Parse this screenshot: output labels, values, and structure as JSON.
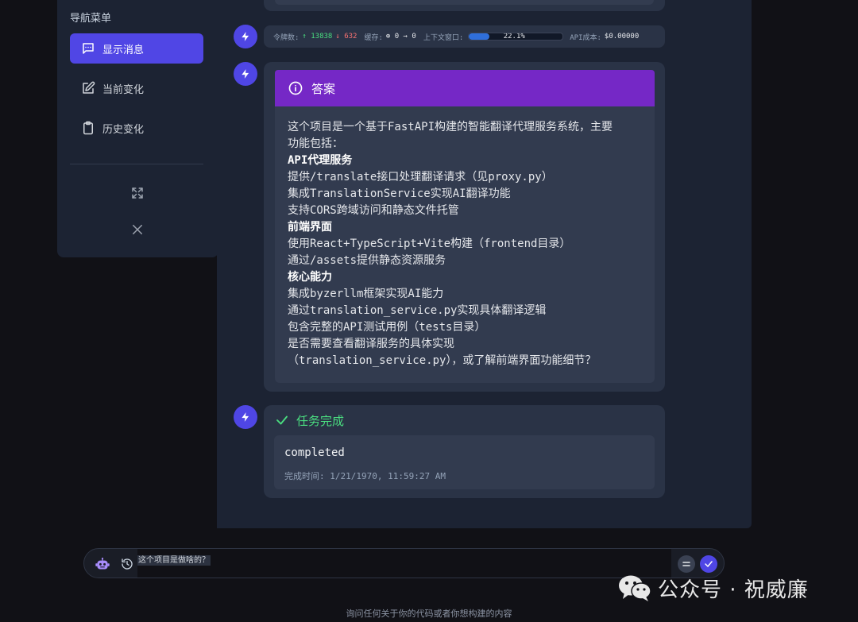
{
  "sidebar": {
    "title": "导航菜单",
    "items": [
      {
        "label": "显示消息",
        "icon": "chat-bubble-icon",
        "active": true
      },
      {
        "label": "当前变化",
        "icon": "edit-icon",
        "active": false
      },
      {
        "label": "历史变化",
        "icon": "clipboard-icon",
        "active": false
      }
    ],
    "expand_icon": "expand-icon",
    "close_icon": "close-icon"
  },
  "token_bar": {
    "tokens_label": "令牌数:",
    "tokens_up": "↑ 13838",
    "tokens_down": "↓ 632",
    "cache_label": "缓存:",
    "cache_value": "⊕ 0 → 0",
    "context_label": "上下文窗口:",
    "context_percent": 22.1,
    "context_percent_text": "22.1%",
    "cost_label": "API成本:",
    "cost_value": "$0.00000"
  },
  "answer": {
    "title": "答案",
    "lines": [
      {
        "text": "这个项目是一个基于FastAPI构建的智能翻译代理服务系统，主要",
        "bold": false
      },
      {
        "text": "功能包括：",
        "bold": false
      },
      {
        "text": "API代理服务",
        "bold": true
      },
      {
        "text": "提供/translate接口处理翻译请求（见proxy.py）",
        "bold": false
      },
      {
        "text": "集成TranslationService实现AI翻译功能",
        "bold": false
      },
      {
        "text": "支持CORS跨域访问和静态文件托管",
        "bold": false
      },
      {
        "text": "前端界面",
        "bold": true
      },
      {
        "text": "使用React+TypeScript+Vite构建（frontend目录）",
        "bold": false
      },
      {
        "text": "通过/assets提供静态资源服务",
        "bold": false
      },
      {
        "text": "核心能力",
        "bold": true
      },
      {
        "text": "集成byzerllm框架实现AI能力",
        "bold": false
      },
      {
        "text": "通过translation_service.py实现具体翻译逻辑",
        "bold": false
      },
      {
        "text": "包含完整的API测试用例（tests目录）",
        "bold": false
      },
      {
        "text": "是否需要查看翻译服务的具体实现",
        "bold": false
      },
      {
        "text": "（translation_service.py），或了解前端界面功能细节？",
        "bold": false
      }
    ]
  },
  "task": {
    "title": "任务完成",
    "status": "completed",
    "time": "完成时间: 1/21/1970, 11:59:27 AM"
  },
  "input": {
    "value": "这个项目是做啥的？",
    "hint": "询问任何关于你的代码或者你想构建的内容"
  },
  "watermark": {
    "text": "公众号 · 祝威廉"
  },
  "colors": {
    "accent": "#4f46e5",
    "answer_header": "#7528c6",
    "success": "#4ade80",
    "token_up": "#4ade80",
    "token_down": "#f87171"
  }
}
